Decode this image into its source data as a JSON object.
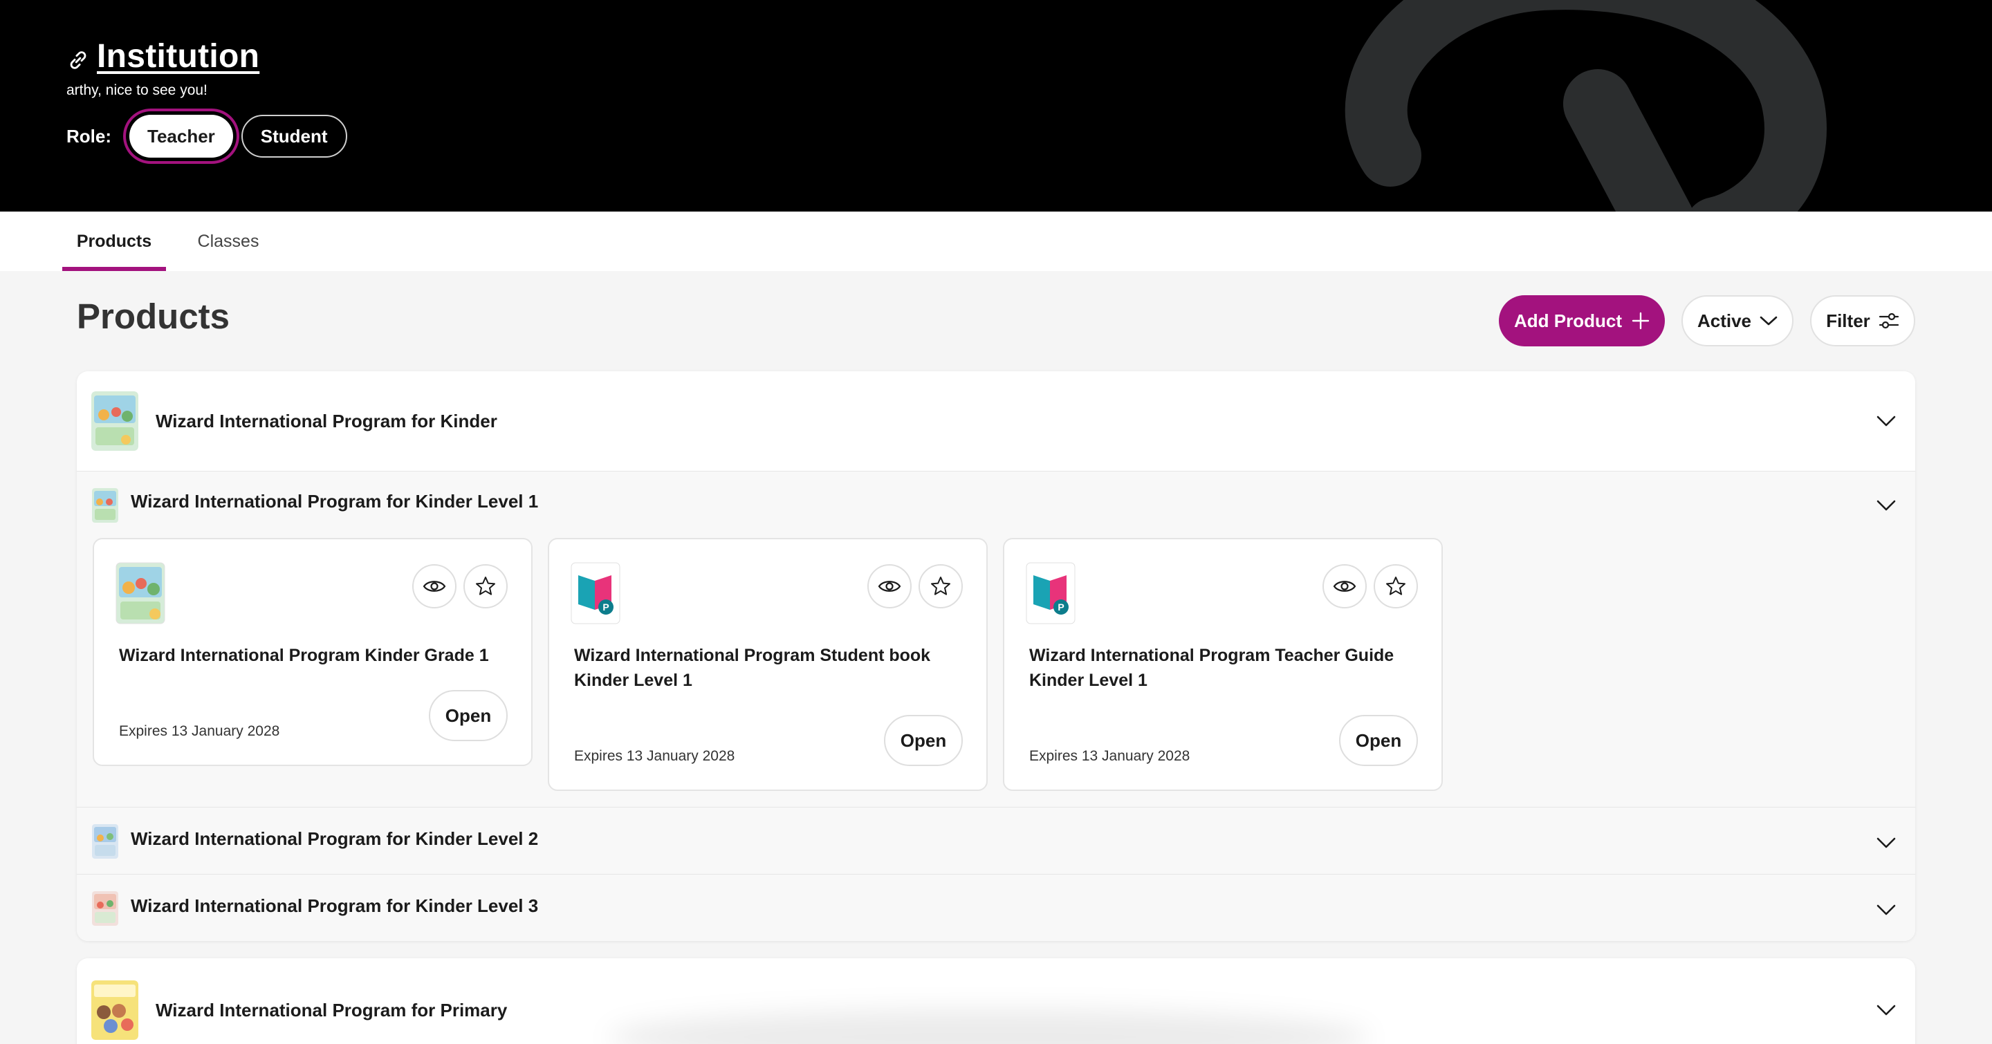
{
  "header": {
    "institution_title": "Institution",
    "greeting": "arthy, nice to see you!",
    "role_label": "Role:",
    "roles": [
      {
        "label": "Teacher",
        "selected": true
      },
      {
        "label": "Student",
        "selected": false
      }
    ]
  },
  "tabs": [
    {
      "label": "Products",
      "active": true
    },
    {
      "label": "Classes",
      "active": false
    }
  ],
  "main": {
    "title": "Products",
    "add_product_label": "Add Product",
    "status_filter_label": "Active",
    "filter_label": "Filter"
  },
  "groups": [
    {
      "title": "Wizard International Program for Kinder",
      "levels": [
        {
          "title": "Wizard International Program for Kinder Level 1",
          "expanded": true,
          "products": [
            {
              "title": "Wizard International Program Kinder Grade 1",
              "expires": "Expires 13 January 2028",
              "open_label": "Open"
            },
            {
              "title": "Wizard International Program Student book Kinder Level 1",
              "expires": "Expires 13 January 2028",
              "open_label": "Open"
            },
            {
              "title": "Wizard International Program Teacher Guide Kinder Level 1",
              "expires": "Expires 13 January 2028",
              "open_label": "Open"
            }
          ]
        },
        {
          "title": "Wizard International Program for Kinder Level 2",
          "expanded": false
        },
        {
          "title": "Wizard International Program for Kinder Level 3",
          "expanded": false
        }
      ]
    },
    {
      "title": "Wizard International Program for Primary"
    }
  ],
  "colors": {
    "accent": "#a3127e",
    "header_bg": "#000000",
    "page_bg": "#f5f5f5"
  }
}
